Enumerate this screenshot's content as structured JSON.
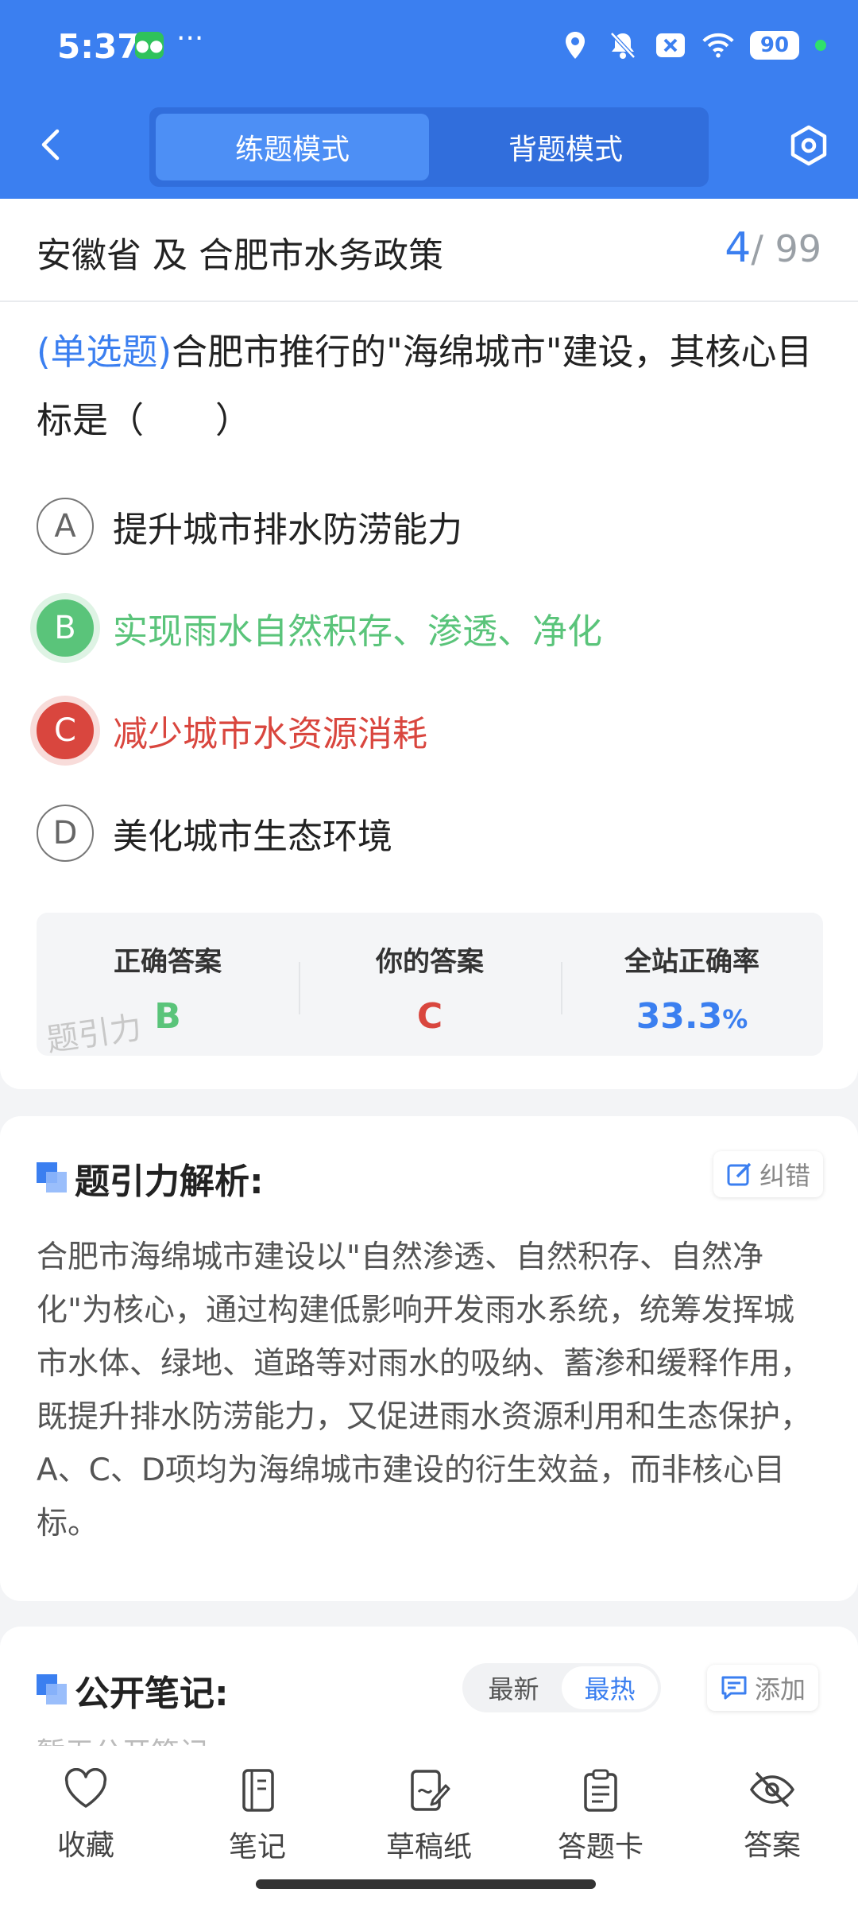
{
  "status_bar": {
    "time": "5:37",
    "dots": "···",
    "battery": "90"
  },
  "nav": {
    "tabs": [
      {
        "label": "练题模式",
        "active": true
      },
      {
        "label": "背题模式",
        "active": false
      }
    ]
  },
  "subject": {
    "title": "安徽省 及 合肥市水务政策",
    "current": "4",
    "sep_total": "/ 99"
  },
  "question": {
    "type": "(单选题)",
    "text": "合肥市推行的\"海绵城市\"建设，其核心目标是（　　）",
    "options": [
      {
        "letter": "A",
        "text": "提升城市排水防涝能力",
        "state": "normal"
      },
      {
        "letter": "B",
        "text": "实现雨水自然积存、渗透、净化",
        "state": "correct"
      },
      {
        "letter": "C",
        "text": "减少城市水资源消耗",
        "state": "wrong"
      },
      {
        "letter": "D",
        "text": "美化城市生态环境",
        "state": "normal"
      }
    ]
  },
  "answer_summary": {
    "correct_label": "正确答案",
    "correct_value": "B",
    "yours_label": "你的答案",
    "yours_value": "C",
    "rate_label": "全站正确率",
    "rate_value": "33.3",
    "rate_unit": "%",
    "watermark": "题引力"
  },
  "analysis": {
    "title": "题引力解析:",
    "correction_label": "纠错",
    "body": "合肥市海绵城市建设以\"自然渗透、自然积存、自然净化\"为核心，通过构建低影响开发雨水系统，统筹发挥城市水体、绿地、道路等对雨水的吸纳、蓄渗和缓释作用，既提升排水防涝能力，又促进雨水资源利用和生态保护，A、C、D项均为海绵城市建设的衍生效益，而非核心目标。"
  },
  "notes": {
    "title": "公开笔记:",
    "sort_options": [
      {
        "label": "最新",
        "active": false
      },
      {
        "label": "最热",
        "active": true
      }
    ],
    "add_label": "添加",
    "placeholder": "暂无公开笔记"
  },
  "bottom_nav": [
    {
      "icon": "heart-icon",
      "label": "收藏"
    },
    {
      "icon": "notebook-icon",
      "label": "笔记"
    },
    {
      "icon": "draft-paper-icon",
      "label": "草稿纸"
    },
    {
      "icon": "answer-sheet-icon",
      "label": "答题卡"
    },
    {
      "icon": "eye-off-icon",
      "label": "答案"
    }
  ],
  "colors": {
    "primary": "#3b7ff0",
    "correct": "#5ac47a",
    "wrong": "#d9463e"
  }
}
